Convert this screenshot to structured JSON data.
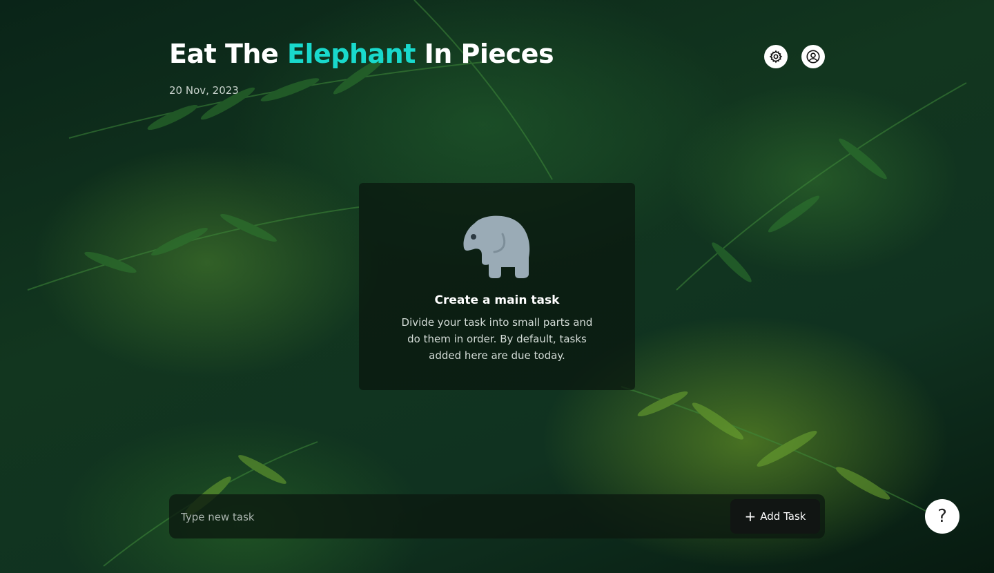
{
  "header": {
    "title_part1": "Eat The ",
    "title_accent": "Elephant",
    "title_part2": " In Pieces",
    "date": "20 Nov, 2023",
    "accent_color": "#19d9cc"
  },
  "toolbar": {
    "settings_icon": "gear-icon",
    "profile_icon": "user-circle-icon"
  },
  "empty_state": {
    "icon": "elephant-icon",
    "title": "Create a main task",
    "description": "Divide your task into small parts and do them in order.  By default, tasks added here are due today."
  },
  "task_input": {
    "placeholder": "Type new task",
    "value": "",
    "add_button_label": "Add Task",
    "add_button_icon": "plus-icon"
  },
  "help": {
    "label": "?"
  }
}
